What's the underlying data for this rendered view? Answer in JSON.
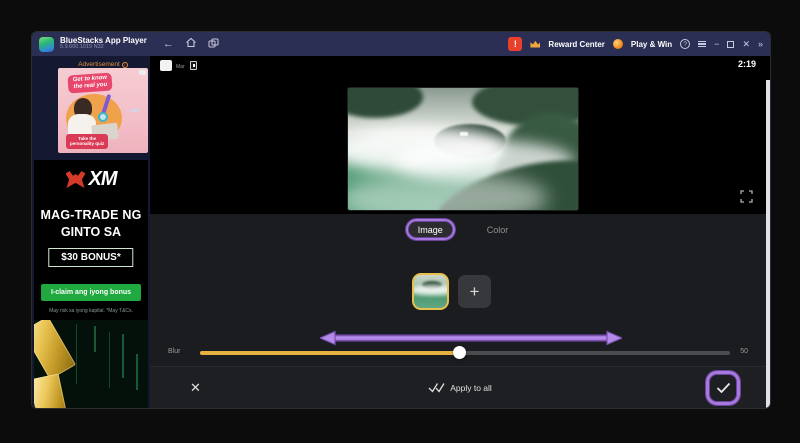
{
  "titlebar": {
    "app_title": "BlueStacks App Player",
    "version_text": "5.9.600.1019 N32",
    "reward_center": "Reward Center",
    "play_and_win": "Play & Win"
  },
  "sidebar": {
    "ad_label": "Advertisement",
    "ad1": {
      "bubble_line1": "Get to know",
      "bubble_line2": "the real you",
      "badge_line1": "Take the",
      "badge_line2": "personality quiz"
    },
    "xm": {
      "logo_text": "XM",
      "headline_line1": "MAG-TRADE NG",
      "headline_line2": "GINTO SA",
      "bonus_text": "$30 BONUS*",
      "cta_label": "I-claim ang iyong bonus",
      "disclaimer": "May risk sa iyong kapital. *May T&Cs."
    }
  },
  "app": {
    "file_label": "Mar",
    "clock": "2:19",
    "tabs": [
      {
        "label": "Image",
        "active": true
      },
      {
        "label": "Color",
        "active": false
      }
    ],
    "blur": {
      "label": "Blur",
      "value": "50",
      "percent": 49
    },
    "apply_to_all_label": "Apply to all"
  },
  "glyphs": {
    "back": "←",
    "alert": "!",
    "help": "?",
    "minimize": "−",
    "collapse": "»",
    "close": "✕",
    "plus": "+",
    "info": "i"
  },
  "colors": {
    "annotation_purple": "#a678e0",
    "slider_gold": "#e6b13e",
    "selected_border_gold": "#e8c14d",
    "cta_green": "#1fa93e",
    "ad_orange": "#e09040",
    "titlebar_navy": "#2c2f54"
  }
}
